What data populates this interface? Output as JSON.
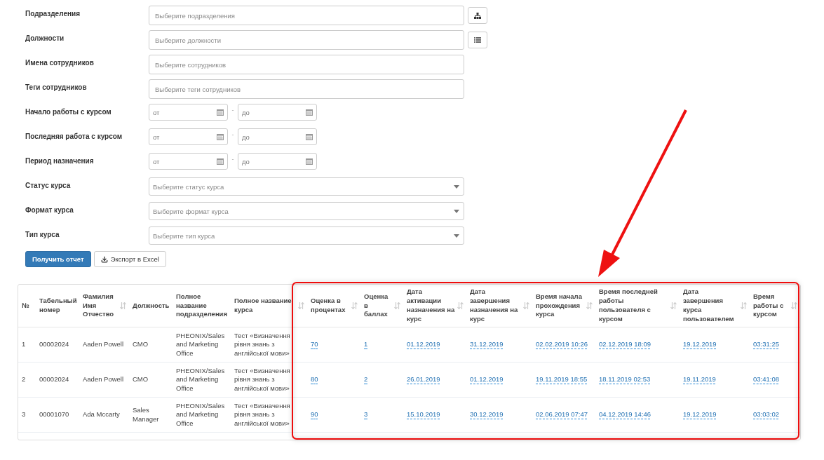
{
  "filters": [
    {
      "label": "Подразделения",
      "kind": "text",
      "placeholder": "Выберите подразделения",
      "side_button": {
        "kind": "tree"
      }
    },
    {
      "label": "Должности",
      "kind": "text",
      "placeholder": "Выберите должности",
      "side_button": {
        "kind": "list"
      }
    },
    {
      "label": "Имена сотрудников",
      "kind": "text",
      "placeholder": "Выберите сотрудников"
    },
    {
      "label": "Теги сотрудников",
      "kind": "text",
      "placeholder": "Выберите теги сотрудников"
    },
    {
      "label": "Начало работы с курсом",
      "kind": "date-range",
      "from_placeholder": "от",
      "separator": "-",
      "to_placeholder": "до"
    },
    {
      "label": "Последняя работа с курсом",
      "kind": "date-range",
      "from_placeholder": "от",
      "separator": "-",
      "to_placeholder": "до"
    },
    {
      "label": "Период назначения",
      "kind": "date-range",
      "from_placeholder": "от",
      "separator": "-",
      "to_placeholder": "до"
    },
    {
      "label": "Статус курса",
      "kind": "dropdown",
      "placeholder": "Выберите статус курса"
    },
    {
      "label": "Формат курса",
      "kind": "dropdown",
      "placeholder": "Выберите формат курса"
    },
    {
      "label": "Тип курса",
      "kind": "dropdown",
      "placeholder": "Выберите тип курса"
    }
  ],
  "buttons": [
    {
      "label": "Получить отчет",
      "kind": "primary"
    },
    {
      "label": "Экспорт в Excel",
      "kind": "export"
    }
  ],
  "table": {
    "columns": [
      {
        "label": "№",
        "sortable": false,
        "kind": "text"
      },
      {
        "label": "Табельный номер",
        "sortable": false,
        "kind": "text"
      },
      {
        "label": "Фамилия Имя Отчество",
        "sortable": true,
        "kind": "text"
      },
      {
        "label": "Должность",
        "sortable": false,
        "kind": "text"
      },
      {
        "label": "Полное название подразделения",
        "sortable": false,
        "kind": "text"
      },
      {
        "label": "Полное название курса",
        "sortable": true,
        "kind": "text"
      },
      {
        "label": "Оценка в процентах",
        "sortable": true,
        "kind": "link"
      },
      {
        "label": "Оценка в баллах",
        "sortable": true,
        "kind": "link"
      },
      {
        "label": "Дата активации назначения на курс",
        "sortable": true,
        "kind": "link"
      },
      {
        "label": "Дата завершения назначения на курс",
        "sortable": true,
        "kind": "link"
      },
      {
        "label": "Время начала прохождения курса",
        "sortable": true,
        "kind": "link"
      },
      {
        "label": "Время последней работы пользователя с курсом",
        "sortable": true,
        "kind": "link"
      },
      {
        "label": "Дата завершения курса пользователем",
        "sortable": true,
        "kind": "link"
      },
      {
        "label": "Время работы с курсом",
        "sortable": true,
        "kind": "link"
      }
    ],
    "rows": [
      [
        "1",
        "00002024",
        "Aaden Powell",
        "CMO",
        "PHEONIX/Sales and Marketing Office",
        "Тест «Визначення рівня знань з англійської мови»",
        "70",
        "1",
        "01.12.2019",
        "31.12.2019",
        "02.02.2019 10:26",
        "02.12.2019 18:09",
        "19.12.2019",
        "03:31:25"
      ],
      [
        "2",
        "00002024",
        "Aaden Powell",
        "CMO",
        "PHEONIX/Sales and Marketing Office",
        "Тест «Визначення рівня знань з англійської мови»",
        "80",
        "2",
        "26.01.2019",
        "01.12.2019",
        "19.11.2019 18:55",
        "18.11.2019 02:53",
        "19.11.2019",
        "03:41:08"
      ],
      [
        "3",
        "00001070",
        "Ada Mccarty",
        "Sales Manager",
        "PHEONIX/Sales and Marketing Office",
        "Тест «Визначення рівня знань з англійської мови»",
        "90",
        "3",
        "15.10.2019",
        "30.12.2019",
        "02.06.2019 07:47",
        "04.12.2019 14:46",
        "19.12.2019",
        "03:03:02"
      ]
    ]
  }
}
